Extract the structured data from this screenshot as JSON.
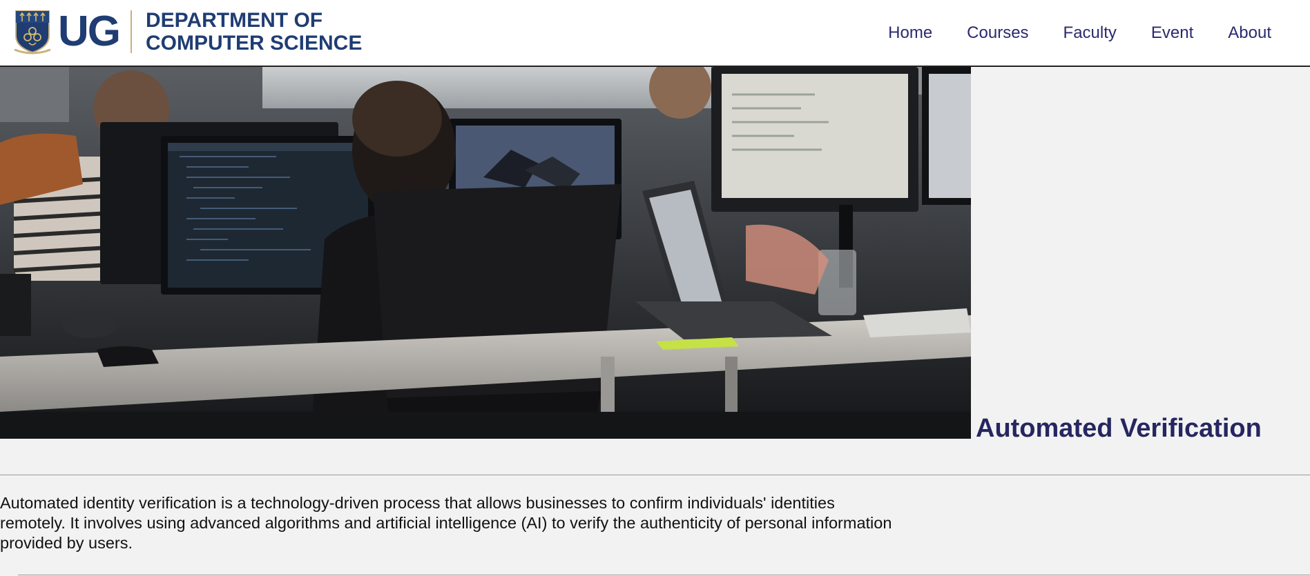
{
  "header": {
    "logo": {
      "initials": "UG",
      "line1": "DEPARTMENT OF",
      "line2": "COMPUTER SCIENCE"
    },
    "nav": [
      {
        "label": "Home"
      },
      {
        "label": "Courses"
      },
      {
        "label": "Faculty"
      },
      {
        "label": "Event"
      },
      {
        "label": "About"
      }
    ]
  },
  "hero": {
    "image": "photo of developers working at desks with multiple monitors"
  },
  "content": {
    "title": "Automated Verification",
    "description": "Automated identity verification is a technology-driven process that allows businesses to confirm individuals' identities remotely. It involves using advanced algorithms and artificial intelligence (AI) to verify the authenticity of personal information provided by users."
  },
  "colors": {
    "brand_navy": "#1f3d73",
    "nav_text": "#2a2a6e",
    "title_text": "#262660",
    "page_bg": "#f2f2f2"
  }
}
